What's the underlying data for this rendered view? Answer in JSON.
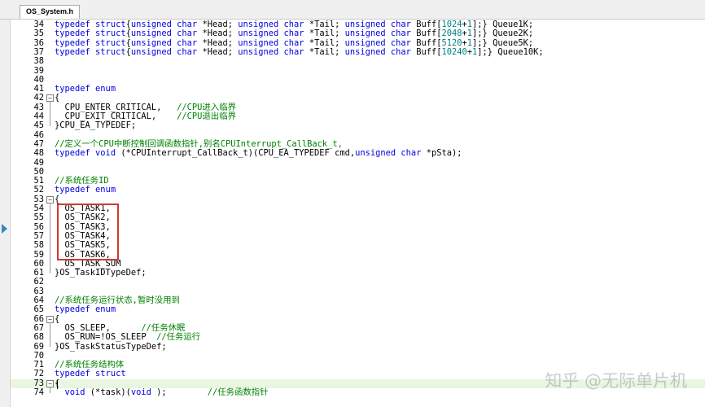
{
  "tab": {
    "label": "OS_System.h"
  },
  "watermark": "知乎 @无际单片机",
  "lines": [
    {
      "n": 34,
      "fold": "",
      "tokens": [
        [
          "kw",
          "typedef struct"
        ],
        [
          "",
          "{"
        ],
        [
          "kw",
          "unsigned char"
        ],
        [
          "",
          " *Head; "
        ],
        [
          "kw",
          "unsigned char"
        ],
        [
          "",
          " *Tail; "
        ],
        [
          "kw",
          "unsigned char"
        ],
        [
          "",
          " Buff["
        ],
        [
          "num",
          "1024"
        ],
        [
          "",
          "+"
        ],
        [
          "num",
          "1"
        ],
        [
          "",
          "];} Queue1K;"
        ]
      ]
    },
    {
      "n": 35,
      "fold": "",
      "tokens": [
        [
          "kw",
          "typedef struct"
        ],
        [
          "",
          "{"
        ],
        [
          "kw",
          "unsigned char"
        ],
        [
          "",
          " *Head; "
        ],
        [
          "kw",
          "unsigned char"
        ],
        [
          "",
          " *Tail; "
        ],
        [
          "kw",
          "unsigned char"
        ],
        [
          "",
          " Buff["
        ],
        [
          "num",
          "2048"
        ],
        [
          "",
          "+"
        ],
        [
          "num",
          "1"
        ],
        [
          "",
          "];} Queue2K;"
        ]
      ]
    },
    {
      "n": 36,
      "fold": "",
      "tokens": [
        [
          "kw",
          "typedef struct"
        ],
        [
          "",
          "{"
        ],
        [
          "kw",
          "unsigned char"
        ],
        [
          "",
          " *Head; "
        ],
        [
          "kw",
          "unsigned char"
        ],
        [
          "",
          " *Tail; "
        ],
        [
          "kw",
          "unsigned char"
        ],
        [
          "",
          " Buff["
        ],
        [
          "num",
          "5120"
        ],
        [
          "",
          "+"
        ],
        [
          "num",
          "1"
        ],
        [
          "",
          "];} Queue5K;"
        ]
      ]
    },
    {
      "n": 37,
      "fold": "",
      "tokens": [
        [
          "kw",
          "typedef struct"
        ],
        [
          "",
          "{"
        ],
        [
          "kw",
          "unsigned char"
        ],
        [
          "",
          " *Head; "
        ],
        [
          "kw",
          "unsigned char"
        ],
        [
          "",
          " *Tail; "
        ],
        [
          "kw",
          "unsigned char"
        ],
        [
          "",
          " Buff["
        ],
        [
          "num",
          "10240"
        ],
        [
          "",
          "+"
        ],
        [
          "num",
          "1"
        ],
        [
          "",
          "];} Queue10K;"
        ]
      ]
    },
    {
      "n": 38,
      "fold": "",
      "tokens": []
    },
    {
      "n": 39,
      "fold": "",
      "tokens": []
    },
    {
      "n": 40,
      "fold": "",
      "tokens": []
    },
    {
      "n": 41,
      "fold": "",
      "tokens": [
        [
          "kw",
          "typedef enum"
        ]
      ]
    },
    {
      "n": 42,
      "fold": "box",
      "tokens": [
        [
          "",
          "{"
        ]
      ]
    },
    {
      "n": 43,
      "fold": "",
      "tokens": [
        [
          "",
          "  CPU_ENTER_CRITICAL,   "
        ],
        [
          "cmt",
          "//CPU进入临界"
        ]
      ]
    },
    {
      "n": 44,
      "fold": "",
      "tokens": [
        [
          "",
          "  CPU_EXIT_CRITICAL,    "
        ],
        [
          "cmt",
          "//CPU退出临界"
        ]
      ]
    },
    {
      "n": 45,
      "fold": "",
      "tokens": [
        [
          "",
          "}CPU_EA_TYPEDEF;"
        ]
      ]
    },
    {
      "n": 46,
      "fold": "",
      "tokens": []
    },
    {
      "n": 47,
      "fold": "",
      "tokens": [
        [
          "cmt",
          "//定义一个CPU中断控制回调函数指针,别名CPUInterrupt_CallBack_t,"
        ]
      ]
    },
    {
      "n": 48,
      "fold": "",
      "tokens": [
        [
          "kw",
          "typedef void"
        ],
        [
          "",
          " (*CPUInterrupt_CallBack_t)(CPU_EA_TYPEDEF cmd,"
        ],
        [
          "kw",
          "unsigned char"
        ],
        [
          "",
          " *pSta);"
        ]
      ]
    },
    {
      "n": 49,
      "fold": "",
      "tokens": []
    },
    {
      "n": 50,
      "fold": "",
      "tokens": []
    },
    {
      "n": 51,
      "fold": "",
      "tokens": [
        [
          "cmt",
          "//系统任务ID"
        ]
      ]
    },
    {
      "n": 52,
      "fold": "",
      "tokens": [
        [
          "kw",
          "typedef enum"
        ]
      ]
    },
    {
      "n": 53,
      "fold": "box",
      "tokens": [
        [
          "",
          "{"
        ]
      ]
    },
    {
      "n": 54,
      "fold": "",
      "tokens": [
        [
          "",
          "  OS_TASK1,"
        ]
      ]
    },
    {
      "n": 55,
      "fold": "",
      "tokens": [
        [
          "",
          "  OS_TASK2,"
        ]
      ]
    },
    {
      "n": 56,
      "fold": "",
      "tokens": [
        [
          "",
          "  OS_TASK3,"
        ]
      ]
    },
    {
      "n": 57,
      "fold": "",
      "tokens": [
        [
          "",
          "  OS_TASK4,"
        ]
      ]
    },
    {
      "n": 58,
      "fold": "",
      "tokens": [
        [
          "",
          "  OS_TASK5,"
        ]
      ]
    },
    {
      "n": 59,
      "fold": "",
      "tokens": [
        [
          "",
          "  OS_TASK6,"
        ]
      ]
    },
    {
      "n": 60,
      "fold": "",
      "tokens": [
        [
          "",
          "  OS_TASK_SUM"
        ]
      ]
    },
    {
      "n": 61,
      "fold": "",
      "tokens": [
        [
          "",
          "}OS_TaskIDTypeDef;"
        ]
      ]
    },
    {
      "n": 62,
      "fold": "",
      "tokens": []
    },
    {
      "n": 63,
      "fold": "",
      "tokens": []
    },
    {
      "n": 64,
      "fold": "",
      "tokens": [
        [
          "cmt",
          "//系统任务运行状态,暂时没用到"
        ]
      ]
    },
    {
      "n": 65,
      "fold": "",
      "tokens": [
        [
          "kw",
          "typedef enum"
        ]
      ]
    },
    {
      "n": 66,
      "fold": "box",
      "tokens": [
        [
          "",
          "{"
        ]
      ]
    },
    {
      "n": 67,
      "fold": "",
      "tokens": [
        [
          "",
          "  OS_SLEEP,      "
        ],
        [
          "cmt",
          "//任务休眠"
        ]
      ]
    },
    {
      "n": 68,
      "fold": "",
      "tokens": [
        [
          "",
          "  OS_RUN=!OS_SLEEP  "
        ],
        [
          "cmt",
          "//任务运行"
        ]
      ]
    },
    {
      "n": 69,
      "fold": "",
      "tokens": [
        [
          "",
          "}OS_TaskStatusTypeDef;"
        ]
      ]
    },
    {
      "n": 70,
      "fold": "",
      "tokens": []
    },
    {
      "n": 71,
      "fold": "",
      "tokens": [
        [
          "cmt",
          "//系统任务结构体"
        ]
      ]
    },
    {
      "n": 72,
      "fold": "",
      "tokens": [
        [
          "kw",
          "typedef struct"
        ]
      ]
    },
    {
      "n": 73,
      "fold": "box",
      "current": true,
      "tokens": [
        [
          "",
          "{"
        ]
      ]
    },
    {
      "n": 74,
      "fold": "",
      "tokens": [
        [
          "",
          "  "
        ],
        [
          "kw",
          "void"
        ],
        [
          "",
          " (*task)("
        ],
        [
          "kw",
          "void"
        ],
        [
          "",
          " );        "
        ],
        [
          "cmt",
          "//任务函数指针"
        ]
      ]
    }
  ]
}
